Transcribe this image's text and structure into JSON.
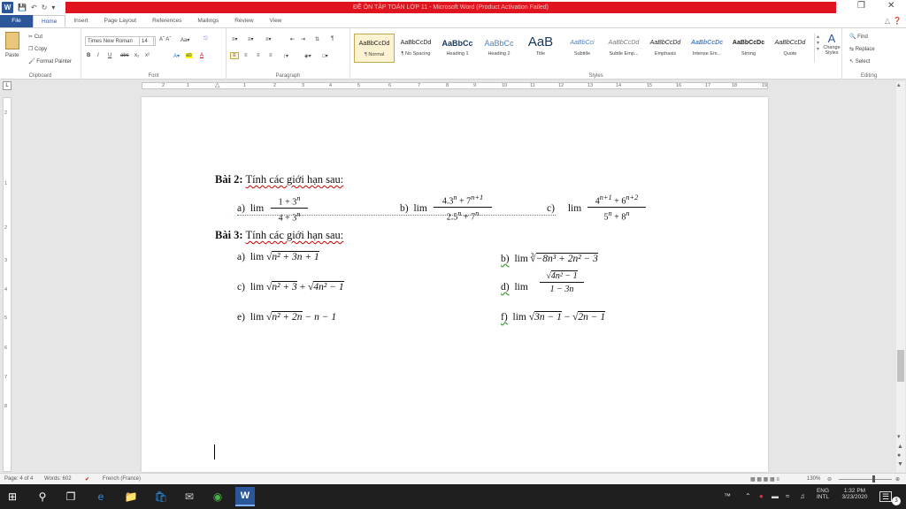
{
  "window": {
    "title": "ĐỀ ÔN TẬP TOÁN LỚP 11 - Microsoft Word (Product Activation Failed)",
    "app_letter": "W"
  },
  "tabs": [
    {
      "label": "File"
    },
    {
      "label": "Home"
    },
    {
      "label": "Insert"
    },
    {
      "label": "Page Layout"
    },
    {
      "label": "References"
    },
    {
      "label": "Mailings"
    },
    {
      "label": "Review"
    },
    {
      "label": "View"
    }
  ],
  "ribbon": {
    "clipboard": {
      "paste": "Paste",
      "cut": "Cut",
      "copy": "Copy",
      "format_painter": "Format Painter",
      "label": "Clipboard"
    },
    "font": {
      "name": "Times New Roman",
      "size": "14",
      "label": "Font"
    },
    "paragraph": {
      "label": "Paragraph"
    },
    "styles": {
      "label": "Styles",
      "items": [
        {
          "sample": "AaBbCcDd",
          "name": "¶ Normal"
        },
        {
          "sample": "AaBbCcDd",
          "name": "¶ No Spacing"
        },
        {
          "sample": "AaBbCc",
          "name": "Heading 1"
        },
        {
          "sample": "AaBbCc",
          "name": "Heading 2"
        },
        {
          "sample": "AaB",
          "name": "Title"
        },
        {
          "sample": "AaBbCci",
          "name": "Subtitle"
        },
        {
          "sample": "AaBbCcDd",
          "name": "Subtle Emp..."
        },
        {
          "sample": "AaBbCcDd",
          "name": "Emphasis"
        },
        {
          "sample": "AaBbCcDc",
          "name": "Intense Em..."
        },
        {
          "sample": "AaBbCcDc",
          "name": "Strong"
        },
        {
          "sample": "AaBbCcDd",
          "name": "Quote"
        }
      ],
      "change_styles": "Change Styles"
    },
    "editing": {
      "find": "Find",
      "replace": "Replace",
      "select": "Select",
      "label": "Editing"
    }
  },
  "ruler": {
    "h_numbers": [
      "2",
      "1",
      "1",
      "2",
      "3",
      "4",
      "5",
      "6",
      "7",
      "8",
      "9",
      "10",
      "11",
      "12",
      "13",
      "14",
      "15",
      "16",
      "17",
      "18",
      "19"
    ],
    "v_numbers": [
      "2",
      "1",
      "2",
      "3",
      "4",
      "5",
      "6",
      "7",
      "8"
    ]
  },
  "document": {
    "bai2_label": "Bài 2:",
    "bai2_text": "Tính các giới hạn sau:",
    "bai3_label": "Bài 3:",
    "bai3_text": "Tính các giới hạn sau:",
    "lim": "lim",
    "bai2": {
      "a": {
        "label": "a)",
        "num": "1 + 3",
        "num_exp": "n",
        "den": "4 + 3",
        "den_exp": "n"
      },
      "b": {
        "label": "b)",
        "num_base1": "4.3",
        "num_exp1": "n",
        "num_base2": "7",
        "num_exp2": "n+1",
        "den_base1": "2.5",
        "den_exp1": "n",
        "den_base2": "7",
        "den_exp2": "n"
      },
      "c": {
        "label": "c)",
        "num_base1": "4",
        "num_exp1": "n+1",
        "num_base2": "6",
        "num_exp2": "n+2",
        "den_base1": "5",
        "den_exp1": "n",
        "den_base2": "8",
        "den_exp2": "n"
      }
    },
    "bai3": {
      "a": {
        "label": "a)",
        "expr": "n² + 3n + 1"
      },
      "b": {
        "label": "b)",
        "root_index": "3",
        "expr": "−8n³ + 2n² − 3"
      },
      "c": {
        "label": "c)",
        "expr1": "n² + 3",
        "expr2": "4n² − 1"
      },
      "d": {
        "label": "d)",
        "num": "4n² − 1",
        "den": "1 − 3n"
      },
      "e": {
        "label": "e)",
        "expr": "n² + 2n",
        "tail": "− n − 1"
      },
      "f": {
        "label": "f)",
        "expr1": "3n − 1",
        "expr2": "2n − 1"
      }
    }
  },
  "status": {
    "page": "Page: 4 of 4",
    "words": "Words: 602",
    "language": "French (France)",
    "zoom": "130%"
  },
  "taskbar": {
    "lang_top": "ENG",
    "lang_bottom": "INTL",
    "time": "1:32 PM",
    "date": "3/23/2020",
    "notifications": "3"
  }
}
